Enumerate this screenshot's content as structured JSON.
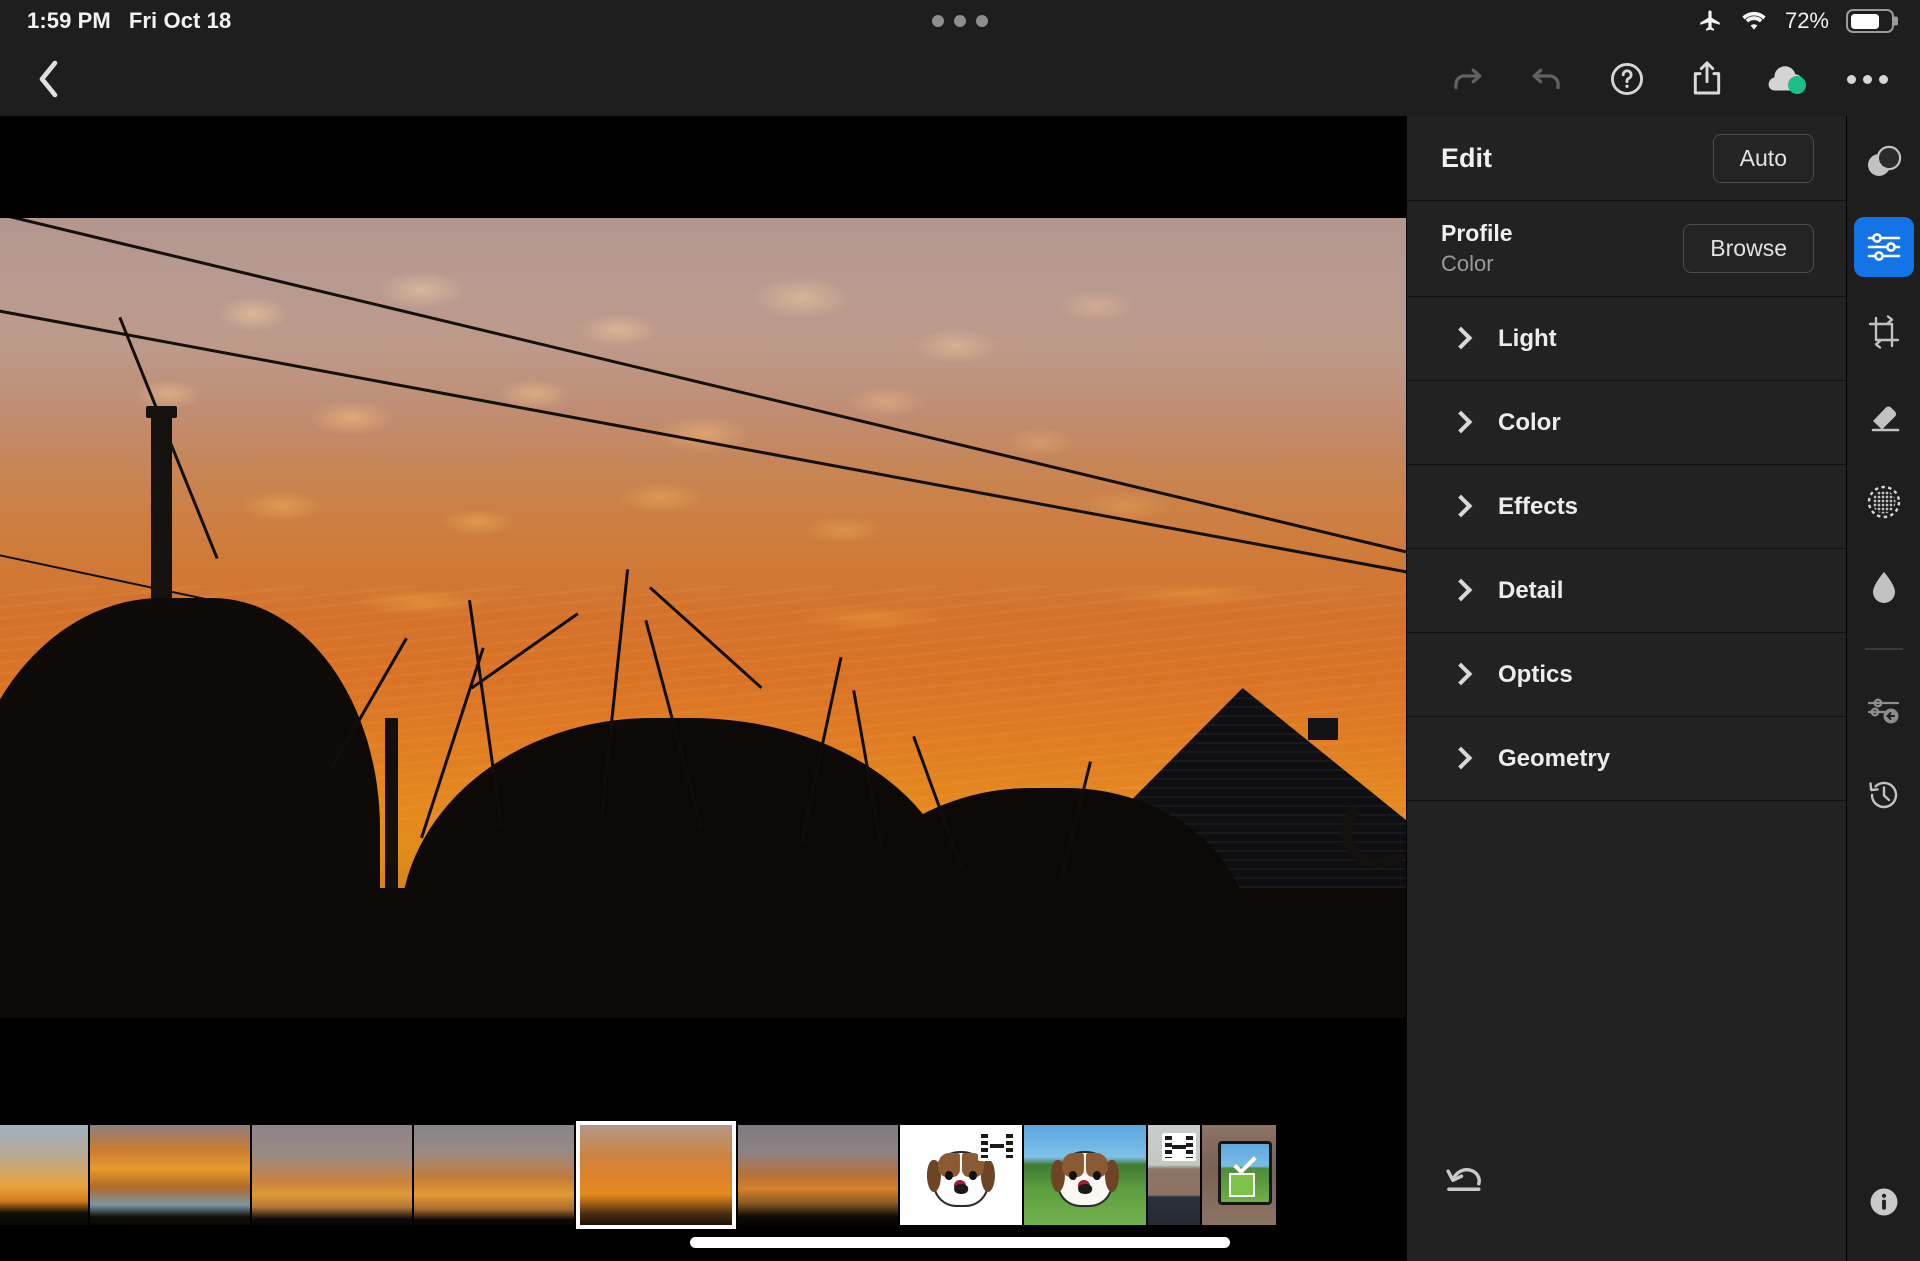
{
  "status_bar": {
    "time": "1:59 PM",
    "date": "Fri Oct 18",
    "battery_percent": "72%",
    "battery_level": 72,
    "icons": [
      "airplane-mode-icon",
      "wifi-icon",
      "battery-icon"
    ],
    "center_indicator": "three-dots-indicator"
  },
  "toolbar": {
    "back_label": "Back",
    "items": [
      {
        "name": "redo-button",
        "label": "Redo",
        "state": "disabled"
      },
      {
        "name": "undo-button",
        "label": "Undo",
        "state": "disabled"
      },
      {
        "name": "help-button",
        "label": "Help"
      },
      {
        "name": "share-button",
        "label": "Share"
      },
      {
        "name": "cloud-sync-button",
        "label": "Cloud Sync",
        "status_color": "#1bbf87"
      },
      {
        "name": "more-options-button",
        "label": "More"
      }
    ]
  },
  "panel": {
    "title": "Edit",
    "auto_label": "Auto",
    "profile": {
      "label": "Profile",
      "value": "Color",
      "browse_label": "Browse"
    },
    "sections": [
      {
        "label": "Light",
        "expanded": false
      },
      {
        "label": "Color",
        "expanded": false
      },
      {
        "label": "Effects",
        "expanded": false
      },
      {
        "label": "Detail",
        "expanded": false
      },
      {
        "label": "Optics",
        "expanded": false
      },
      {
        "label": "Geometry",
        "expanded": false
      }
    ],
    "reset_label": "Reset"
  },
  "rail": {
    "items": [
      {
        "name": "masking-icon",
        "label": "Masking",
        "active": false
      },
      {
        "name": "edit-sliders-icon",
        "label": "Edit",
        "active": true,
        "accent": "#1473e6"
      },
      {
        "name": "crop-rotate-icon",
        "label": "Crop & Rotate",
        "active": false
      },
      {
        "name": "healing-brush-icon",
        "label": "Healing Brush",
        "active": false
      },
      {
        "name": "remove-halftone-icon",
        "label": "Remove",
        "active": false
      },
      {
        "name": "water-drop-icon",
        "label": "Retouch",
        "active": false
      },
      {
        "name": "previous-edits-icon",
        "label": "Previous Edits",
        "active": false
      },
      {
        "name": "version-history-icon",
        "label": "Versions",
        "active": false
      }
    ],
    "info_label": "Info"
  },
  "photo": {
    "description": "Orange sunset sky with mammatus clouds, power lines, utility pole, silhouetted trees and a house roof",
    "accent_sky": "#d4722c",
    "upper_sky": "#b2968f",
    "glow": "#e4881f"
  },
  "filmstrip": {
    "selected_index": 4,
    "thumbs": [
      {
        "name": "thumb-sunset-1",
        "kind": "photo",
        "style": "sk-a",
        "selected": false,
        "video": false
      },
      {
        "name": "thumb-sunset-2",
        "kind": "photo",
        "style": "sk-b",
        "selected": false,
        "video": false
      },
      {
        "name": "thumb-sunset-3",
        "kind": "photo",
        "style": "sk-c",
        "selected": false,
        "video": false
      },
      {
        "name": "thumb-sunset-4",
        "kind": "photo",
        "style": "sk-d",
        "selected": false,
        "video": false
      },
      {
        "name": "thumb-sunset-5",
        "kind": "photo",
        "style": "sk-e",
        "selected": true,
        "video": false
      },
      {
        "name": "thumb-sunset-6",
        "kind": "photo",
        "style": "sk-f",
        "selected": false,
        "video": false
      },
      {
        "name": "thumb-dog-sketch",
        "kind": "illustration",
        "style": "thumb-dog-sketch",
        "selected": false,
        "video": true
      },
      {
        "name": "thumb-dog-color",
        "kind": "illustration",
        "style": "thumb-dog-color",
        "selected": false,
        "video": false
      },
      {
        "name": "thumb-person",
        "kind": "photo",
        "style": "th-person",
        "selected": false,
        "video": true
      },
      {
        "name": "thumb-ipad",
        "kind": "photo",
        "style": "th-ipad",
        "selected": false,
        "video": false
      }
    ]
  },
  "home_indicator": "home-indicator"
}
